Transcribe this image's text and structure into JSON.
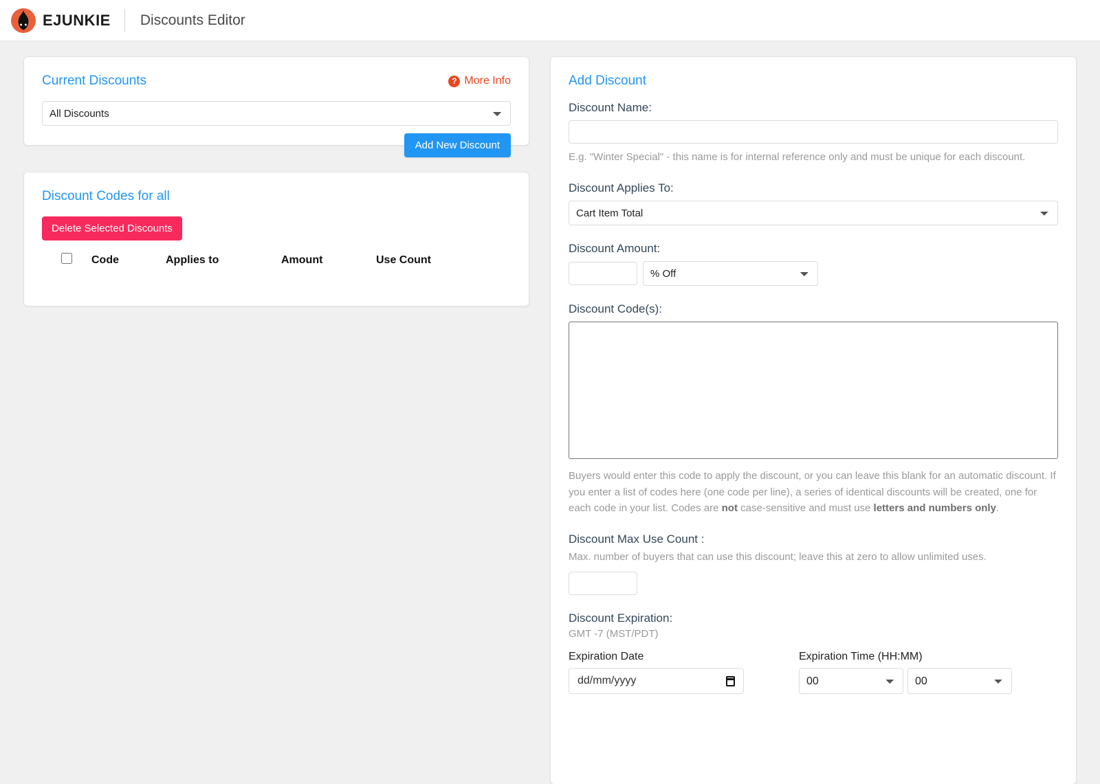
{
  "header": {
    "brand_name": "EJUNKIE",
    "page_title": "Discounts Editor",
    "logo_icon": "flame-logo-icon"
  },
  "colors": {
    "accent_blue": "#2196f3",
    "brand_orange": "#e8603c",
    "link_orange": "#e8461e",
    "danger_pink": "#f8295c",
    "label_slate": "#33475b",
    "page_bg": "#f0f0f0"
  },
  "current_discounts": {
    "title": "Current Discounts",
    "more_info_label": "More Info",
    "more_info_icon": "question-circle-icon",
    "filter_selected": "All Discounts",
    "filter_options": [
      "All Discounts"
    ],
    "add_new_label": "Add New Discount"
  },
  "discount_codes": {
    "title": "Discount Codes for all",
    "delete_label": "Delete Selected Discounts",
    "columns": [
      "Code",
      "Applies to",
      "Amount",
      "Use Count"
    ],
    "rows": []
  },
  "add_discount": {
    "title": "Add Discount",
    "name": {
      "label": "Discount Name:",
      "value": "",
      "placeholder": "",
      "hint": "E.g. \"Winter Special\" - this name is for internal reference only and must be unique for each discount."
    },
    "applies_to": {
      "label": "Discount Applies To:",
      "selected": "Cart Item Total",
      "options": [
        "Cart Item Total"
      ]
    },
    "amount": {
      "label": "Discount Amount:",
      "value": "",
      "placeholder": "",
      "type_selected": "% Off",
      "type_options": [
        "% Off"
      ]
    },
    "codes": {
      "label": "Discount Code(s):",
      "value": "",
      "placeholder": "",
      "hint_part1": "Buyers would enter this code to apply the discount, or you can leave this blank for an automatic discount. If you enter a list of codes here (one code per line), a series of identical discounts will be created, one for each code in your list. Codes are ",
      "hint_bold1": "not",
      "hint_part2": " case-sensitive and must use ",
      "hint_bold2": "letters and numbers only",
      "hint_part3": "."
    },
    "max_use": {
      "label": "Discount Max Use Count :",
      "hint": "Max. number of buyers that can use this discount; leave this at zero to allow unlimited uses.",
      "value": "",
      "placeholder": ""
    },
    "expiration": {
      "label": "Discount Expiration:",
      "timezone": "GMT -7 (MST/PDT)",
      "date_label": "Expiration Date",
      "date_placeholder": "dd/mm/yyyy",
      "date_icon": "calendar-icon",
      "time_label": "Expiration Time (HH:MM)",
      "hour_selected": "00",
      "hour_options": [
        "00"
      ],
      "minute_selected": "00",
      "minute_options": [
        "00"
      ]
    }
  }
}
